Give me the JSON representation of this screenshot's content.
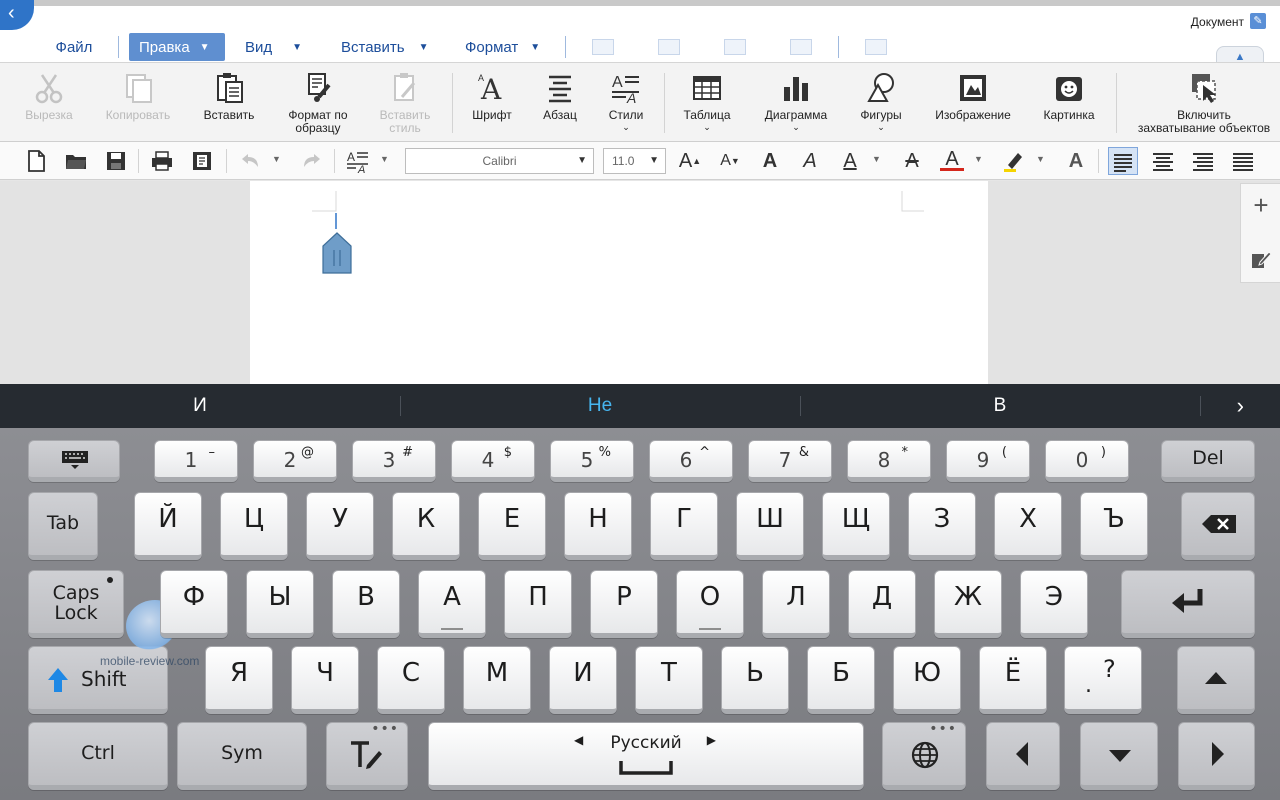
{
  "header": {
    "document_label": "Документ",
    "menus": [
      {
        "label": "Файл",
        "has_dropdown": false
      },
      {
        "label": "Правка",
        "has_dropdown": true,
        "active": true
      },
      {
        "label": "Вид",
        "has_dropdown": true
      },
      {
        "label": "Вставить",
        "has_dropdown": true
      },
      {
        "label": "Формат",
        "has_dropdown": true
      }
    ]
  },
  "ribbon": {
    "cut": "Вырезка",
    "copy": "Копировать",
    "paste": "Вставить",
    "format_painter_1": "Формат по",
    "format_painter_2": "образцу",
    "paste_style_1": "Вставить",
    "paste_style_2": "стиль",
    "font": "Шрифт",
    "paragraph": "Абзац",
    "styles": "Стили",
    "table": "Таблица",
    "chart": "Диаграмма",
    "shapes": "Фигуры",
    "image": "Изображение",
    "clipart": "Картинка",
    "capture_1": "Включить",
    "capture_2": "захватывание объектов"
  },
  "format_toolbar": {
    "font_name": "Calibri",
    "font_size": "11.0",
    "active_alignment": "left"
  },
  "suggestions": {
    "items": [
      "И",
      "Не",
      "В"
    ],
    "highlighted": "Не"
  },
  "keyboard": {
    "row1": [
      {
        "main": "1",
        "sub": "–"
      },
      {
        "main": "2",
        "sub": "@"
      },
      {
        "main": "3",
        "sub": "#"
      },
      {
        "main": "4",
        "sub": "$"
      },
      {
        "main": "5",
        "sub": "%"
      },
      {
        "main": "6",
        "sub": "^"
      },
      {
        "main": "7",
        "sub": "&"
      },
      {
        "main": "8",
        "sub": "*"
      },
      {
        "main": "9",
        "sub": "("
      },
      {
        "main": "0",
        "sub": ")"
      }
    ],
    "del": "Del",
    "tab": "Tab",
    "row2": [
      "Й",
      "Ц",
      "У",
      "К",
      "Е",
      "Н",
      "Г",
      "Ш",
      "Щ",
      "З",
      "Х",
      "Ъ"
    ],
    "caps_1": "Caps",
    "caps_2": "Lock",
    "row3": [
      "Ф",
      "Ы",
      "В",
      "А",
      "П",
      "Р",
      "О",
      "Л",
      "Д",
      "Ж",
      "Э"
    ],
    "shift": "Shift",
    "row4": [
      "Я",
      "Ч",
      "С",
      "М",
      "И",
      "Т",
      "Ь",
      "Б",
      "Ю",
      "Ё"
    ],
    "punct_main": "?",
    "punct_sub": ".",
    "ctrl": "Ctrl",
    "sym": "Sym",
    "language": "Русский"
  },
  "watermark": "mobile-review.com",
  "colors": {
    "accent": "#2f74c8",
    "menu_text": "#1d4e9b",
    "active_menu": "#5f8fd0",
    "suggestion_highlight": "#46b5ef",
    "suggestion_bar": "#262b31",
    "keyboard_bg": "#85868b"
  }
}
